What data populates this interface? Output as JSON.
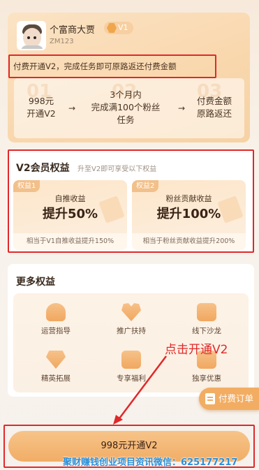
{
  "profile": {
    "name": "个富商大贾",
    "level": "V1",
    "user_id": "ZM123"
  },
  "notice": "付费开通V2，完成任务即可原路返还付费金额",
  "steps": [
    {
      "num": "01",
      "line1": "998元",
      "line2": "开通V2",
      "line3": ""
    },
    {
      "num": "02",
      "line1": "3个月内",
      "line2": "完成满100个粉丝",
      "line3": "任务"
    },
    {
      "num": "03",
      "line1": "付费金额",
      "line2": "原路返还",
      "line3": ""
    }
  ],
  "arrows": [
    "→",
    "→"
  ],
  "rights": {
    "title": "V2会员权益",
    "subtitle": "升至V2即可享受以下权益",
    "items": [
      {
        "tag": "权益1",
        "name": "自推收益",
        "big": "提升50%",
        "note": "相当于V1自推收益提升150%"
      },
      {
        "tag": "权益2",
        "name": "粉丝贡献收益",
        "big": "提升100%",
        "note": "相当于粉丝贡献收益提升200%"
      }
    ]
  },
  "more": {
    "title": "更多权益",
    "items": [
      {
        "label": "运营指导",
        "icon": "person-icon"
      },
      {
        "label": "推广扶持",
        "icon": "heart-icon"
      },
      {
        "label": "线下沙龙",
        "icon": "group-icon"
      },
      {
        "label": "精英拓展",
        "icon": "gem-icon"
      },
      {
        "label": "专享福利",
        "icon": "gift-icon"
      },
      {
        "label": "独享优惠",
        "icon": "coupon-icon"
      }
    ]
  },
  "annotation": "点击开通V2",
  "order_button": "付费订单",
  "pay_button": "998元开通V2",
  "watermark": "聚财赚钱创业项目资讯微信：625177217",
  "colors": {
    "accent": "#f1ad66",
    "highlight_red": "#e0282a",
    "watermark_blue": "#2a8fd8"
  }
}
